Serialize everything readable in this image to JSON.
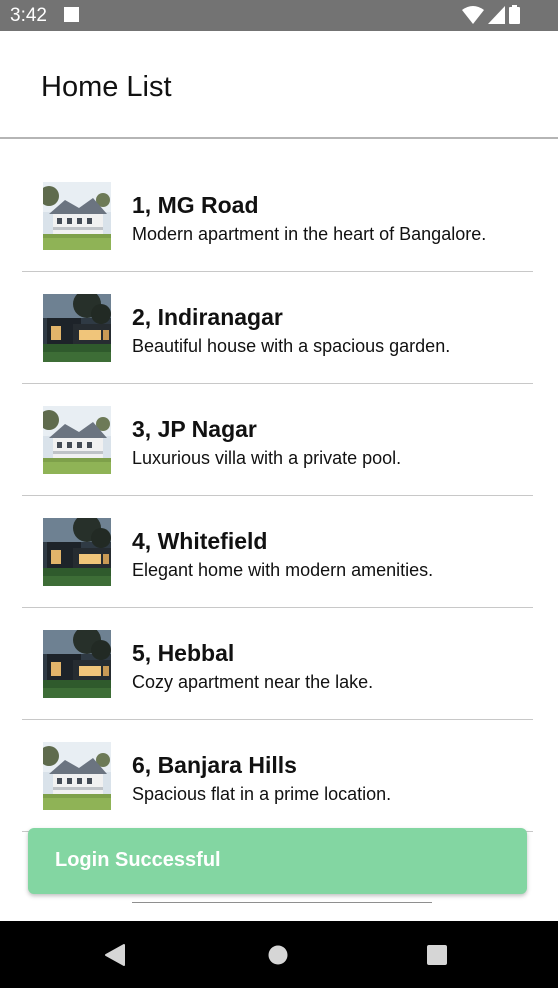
{
  "status_bar": {
    "time": "3:42",
    "icons": [
      "notification-square-icon",
      "wifi-icon",
      "signal-icon",
      "battery-icon"
    ]
  },
  "app_bar": {
    "title": "Home List"
  },
  "homes": [
    {
      "title": "1, MG Road",
      "description": "Modern apartment in the heart of Bangalore.",
      "image": "white-villa-thumbnail"
    },
    {
      "title": "2, Indiranagar",
      "description": "Beautiful house with a spacious garden.",
      "image": "modern-house-night-thumbnail"
    },
    {
      "title": "3, JP Nagar",
      "description": "Luxurious villa with a private pool.",
      "image": "white-villa-thumbnail"
    },
    {
      "title": "4, Whitefield",
      "description": "Elegant home with modern amenities.",
      "image": "modern-house-night-thumbnail"
    },
    {
      "title": "5, Hebbal",
      "description": "Cozy apartment near the lake.",
      "image": "modern-house-night-thumbnail"
    },
    {
      "title": "6, Banjara Hills",
      "description": "Spacious flat in a prime location.",
      "image": "white-villa-thumbnail"
    }
  ],
  "toast": {
    "message": "Login Successful",
    "color": "#83d6a2"
  },
  "nav_bar": {
    "icons": [
      "back-icon",
      "home-icon",
      "recents-icon"
    ]
  },
  "colors": {
    "status_bar": "#737373",
    "divider": "#c8c8c8",
    "nav_bar": "#000000"
  }
}
